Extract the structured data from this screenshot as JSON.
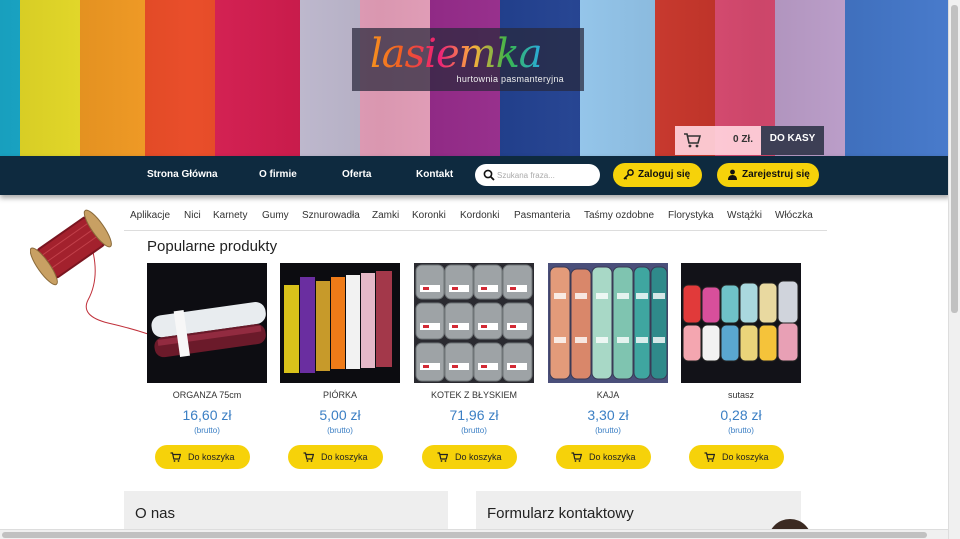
{
  "header": {
    "logo_text": "lasiemka",
    "logo_subtitle": "hurtownia pasmanteryjna",
    "banner_colors": [
      "#1bb5d8",
      "#f2e628",
      "#f59a1e",
      "#e8451f",
      "#d4184c",
      "#c8c2d9",
      "#f2a8c4",
      "#9a2a8e",
      "#1a3a8c",
      "#8fc3ea",
      "#d1362a",
      "#e84f78",
      "#c7a7d6",
      "#3f74c9"
    ],
    "cart_total": "0 Zł.",
    "checkout_label": "DO KASY"
  },
  "nav": {
    "items": [
      {
        "label": "Strona Główna"
      },
      {
        "label": "O firmie"
      },
      {
        "label": "Oferta"
      },
      {
        "label": "Kontakt"
      }
    ],
    "search_placeholder": "Szukana fraza...",
    "login_label": "Zaloguj się",
    "register_label": "Zarejestruj się"
  },
  "categories": [
    {
      "label": "Aplikacje"
    },
    {
      "label": "Nici"
    },
    {
      "label": "Karnety"
    },
    {
      "label": "Gumy"
    },
    {
      "label": "Sznurowadła"
    },
    {
      "label": "Zamki"
    },
    {
      "label": "Koronki"
    },
    {
      "label": "Kordonki"
    },
    {
      "label": "Pasmanteria"
    },
    {
      "label": "Taśmy ozdobne"
    },
    {
      "label": "Florystyka"
    },
    {
      "label": "Wstążki"
    },
    {
      "label": "Włóczka"
    }
  ],
  "popular": {
    "title": "Popularne produkty",
    "add_to_cart_label": "Do koszyka",
    "products": [
      {
        "name": "ORGANZA 75cm",
        "price": "16,60 zł",
        "gross": "(brutto)"
      },
      {
        "name": "PIÓRKA",
        "price": "5,00 zł",
        "gross": "(brutto)"
      },
      {
        "name": "KOTEK Z BŁYSKIEM",
        "price": "71,96 zł",
        "gross": "(brutto)"
      },
      {
        "name": "KAJA",
        "price": "3,30 zł",
        "gross": "(brutto)"
      },
      {
        "name": "sutasz",
        "price": "0,28 zł",
        "gross": "(brutto)"
      }
    ]
  },
  "bottom": {
    "about_title": "O nas",
    "contact_title": "Formularz kontaktowy"
  },
  "colors": {
    "nav_bg": "#0e2a3f",
    "accent_yellow": "#f6d20a",
    "price_blue": "#3b7fc4"
  }
}
